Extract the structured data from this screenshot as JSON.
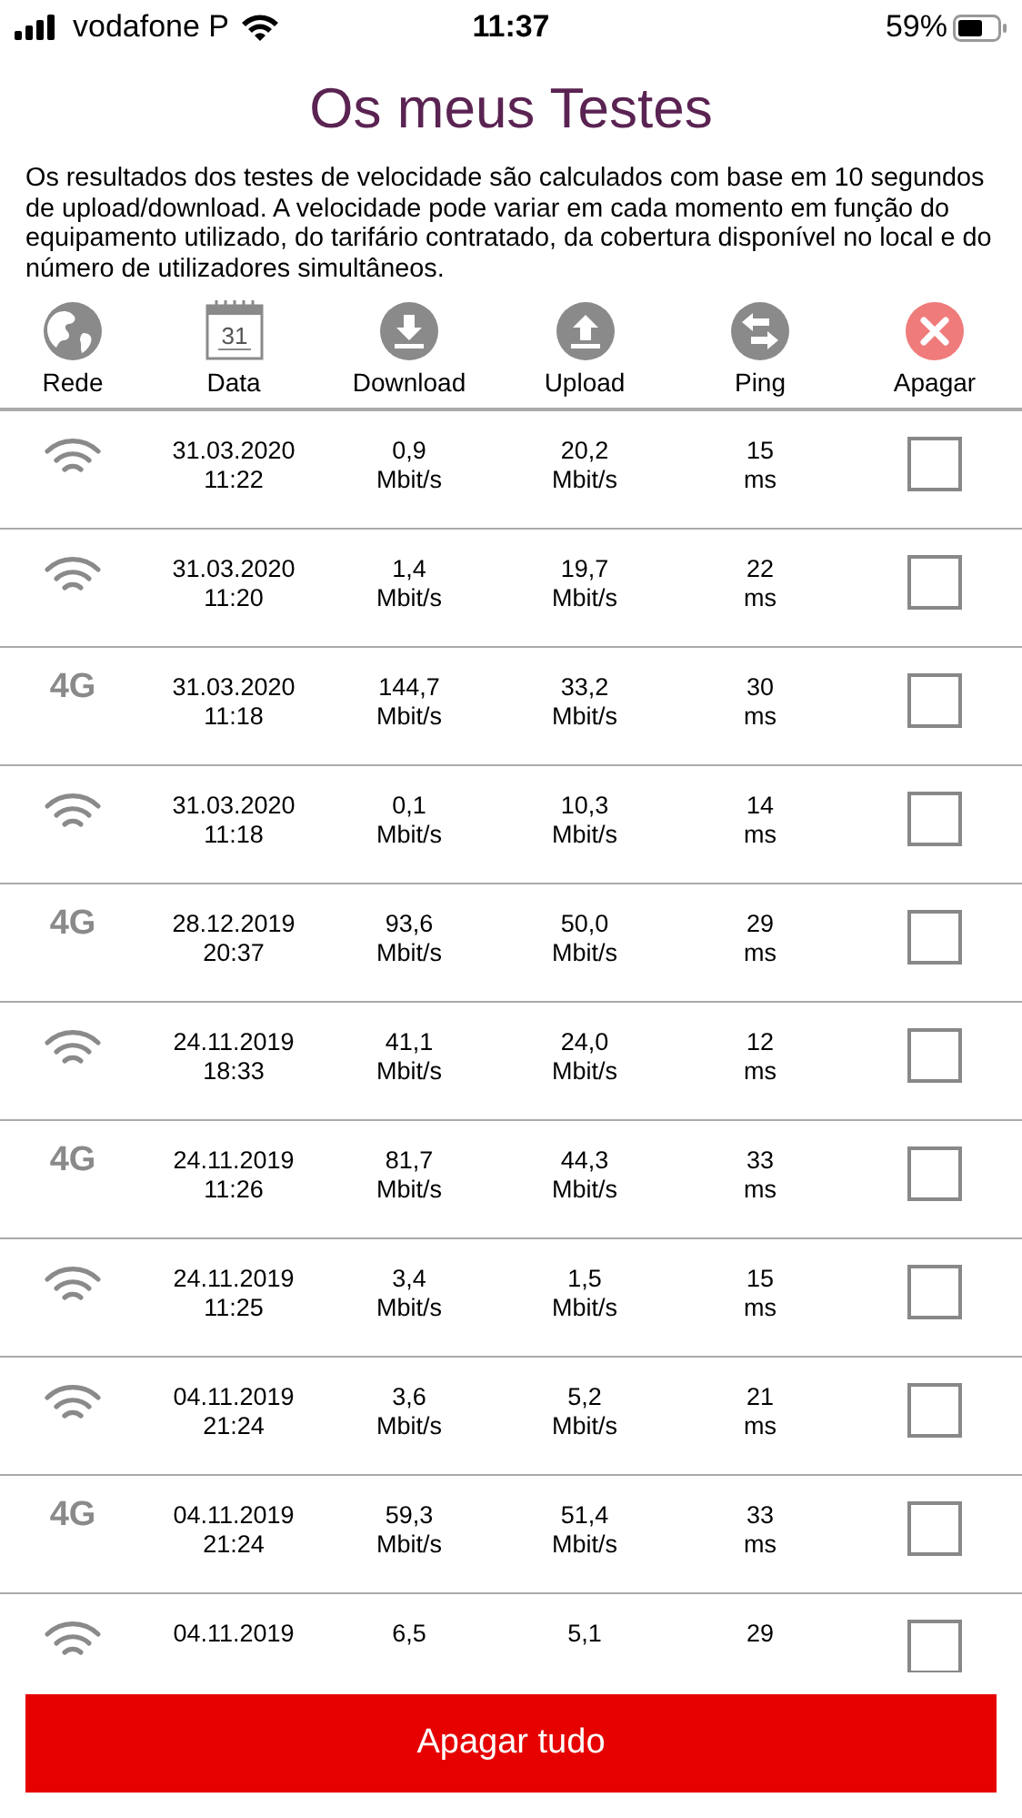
{
  "status_bar": {
    "carrier": "vodafone P",
    "time": "11:37",
    "battery": "59%"
  },
  "title": "Os meus Testes",
  "description": "Os resultados dos testes de velocidade são calculados com base em 10 segundos de upload/download. A velocidade pode variar em cada momento em função do equipamento utilizado, do tarifário contratado, da cobertura disponível no local e do número de utilizadores simultâneos.",
  "columns": [
    {
      "kind": "network",
      "label": "Rede"
    },
    {
      "kind": "date",
      "label": "Data",
      "icon_text": "31"
    },
    {
      "kind": "download",
      "label": "Download"
    },
    {
      "kind": "upload",
      "label": "Upload"
    },
    {
      "kind": "ping",
      "label": "Ping"
    },
    {
      "kind": "delete",
      "label": "Apagar"
    }
  ],
  "rows": [
    {
      "network": {
        "kind": "wifi"
      },
      "date": "31.03.2020",
      "time": "11:22",
      "download": "0,9",
      "download_unit": "Mbit/s",
      "upload": "20,2",
      "upload_unit": "Mbit/s",
      "ping": "15",
      "ping_unit": "ms",
      "checked": false
    },
    {
      "network": {
        "kind": "wifi"
      },
      "date": "31.03.2020",
      "time": "11:20",
      "download": "1,4",
      "download_unit": "Mbit/s",
      "upload": "19,7",
      "upload_unit": "Mbit/s",
      "ping": "22",
      "ping_unit": "ms",
      "checked": false
    },
    {
      "network": {
        "kind": "cellular",
        "label": "4G"
      },
      "date": "31.03.2020",
      "time": "11:18",
      "download": "144,7",
      "download_unit": "Mbit/s",
      "upload": "33,2",
      "upload_unit": "Mbit/s",
      "ping": "30",
      "ping_unit": "ms",
      "checked": false
    },
    {
      "network": {
        "kind": "wifi"
      },
      "date": "31.03.2020",
      "time": "11:18",
      "download": "0,1",
      "download_unit": "Mbit/s",
      "upload": "10,3",
      "upload_unit": "Mbit/s",
      "ping": "14",
      "ping_unit": "ms",
      "checked": false
    },
    {
      "network": {
        "kind": "cellular",
        "label": "4G"
      },
      "date": "28.12.2019",
      "time": "20:37",
      "download": "93,6",
      "download_unit": "Mbit/s",
      "upload": "50,0",
      "upload_unit": "Mbit/s",
      "ping": "29",
      "ping_unit": "ms",
      "checked": false
    },
    {
      "network": {
        "kind": "wifi"
      },
      "date": "24.11.2019",
      "time": "18:33",
      "download": "41,1",
      "download_unit": "Mbit/s",
      "upload": "24,0",
      "upload_unit": "Mbit/s",
      "ping": "12",
      "ping_unit": "ms",
      "checked": false
    },
    {
      "network": {
        "kind": "cellular",
        "label": "4G"
      },
      "date": "24.11.2019",
      "time": "11:26",
      "download": "81,7",
      "download_unit": "Mbit/s",
      "upload": "44,3",
      "upload_unit": "Mbit/s",
      "ping": "33",
      "ping_unit": "ms",
      "checked": false
    },
    {
      "network": {
        "kind": "wifi"
      },
      "date": "24.11.2019",
      "time": "11:25",
      "download": "3,4",
      "download_unit": "Mbit/s",
      "upload": "1,5",
      "upload_unit": "Mbit/s",
      "ping": "15",
      "ping_unit": "ms",
      "checked": false
    },
    {
      "network": {
        "kind": "wifi"
      },
      "date": "04.11.2019",
      "time": "21:24",
      "download": "3,6",
      "download_unit": "Mbit/s",
      "upload": "5,2",
      "upload_unit": "Mbit/s",
      "ping": "21",
      "ping_unit": "ms",
      "checked": false
    },
    {
      "network": {
        "kind": "cellular",
        "label": "4G"
      },
      "date": "04.11.2019",
      "time": "21:24",
      "download": "59,3",
      "download_unit": "Mbit/s",
      "upload": "51,4",
      "upload_unit": "Mbit/s",
      "ping": "33",
      "ping_unit": "ms",
      "checked": false
    },
    {
      "network": {
        "kind": "wifi"
      },
      "date": "04.11.2019",
      "download": "6,5",
      "upload": "5,1",
      "ping": "29",
      "checked": false
    }
  ],
  "button": "Apagar tudo"
}
